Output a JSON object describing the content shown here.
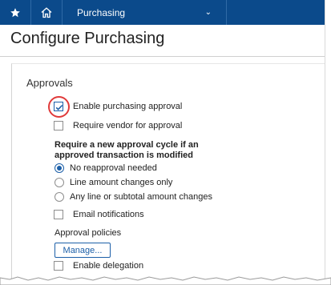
{
  "topbar": {
    "favorites_icon": "star-icon",
    "home_icon": "home-icon",
    "module_label": "Purchasing",
    "module_chevron": "chevron-down-icon",
    "bg_color": "#0b4a8b"
  },
  "page": {
    "title": "Configure Purchasing"
  },
  "approvals": {
    "section_title": "Approvals",
    "enable_purchasing_approval": {
      "label": "Enable purchasing approval",
      "checked": true
    },
    "require_vendor": {
      "label": "Require vendor for approval",
      "checked": false
    },
    "reapproval_question": "Require a new approval cycle if an approved transaction is modified",
    "reapproval_options": [
      {
        "label": "No reapproval needed",
        "selected": true
      },
      {
        "label": "Line amount changes only",
        "selected": false
      },
      {
        "label": "Any line or subtotal amount changes",
        "selected": false
      }
    ],
    "email_notifications": {
      "label": "Email notifications",
      "checked": false
    },
    "policies_label": "Approval policies",
    "manage_button": "Manage...",
    "enable_delegation": {
      "label": "Enable delegation",
      "checked": false
    }
  },
  "colors": {
    "highlight_ring": "#e03a3a",
    "accent": "#1c5fa8"
  }
}
